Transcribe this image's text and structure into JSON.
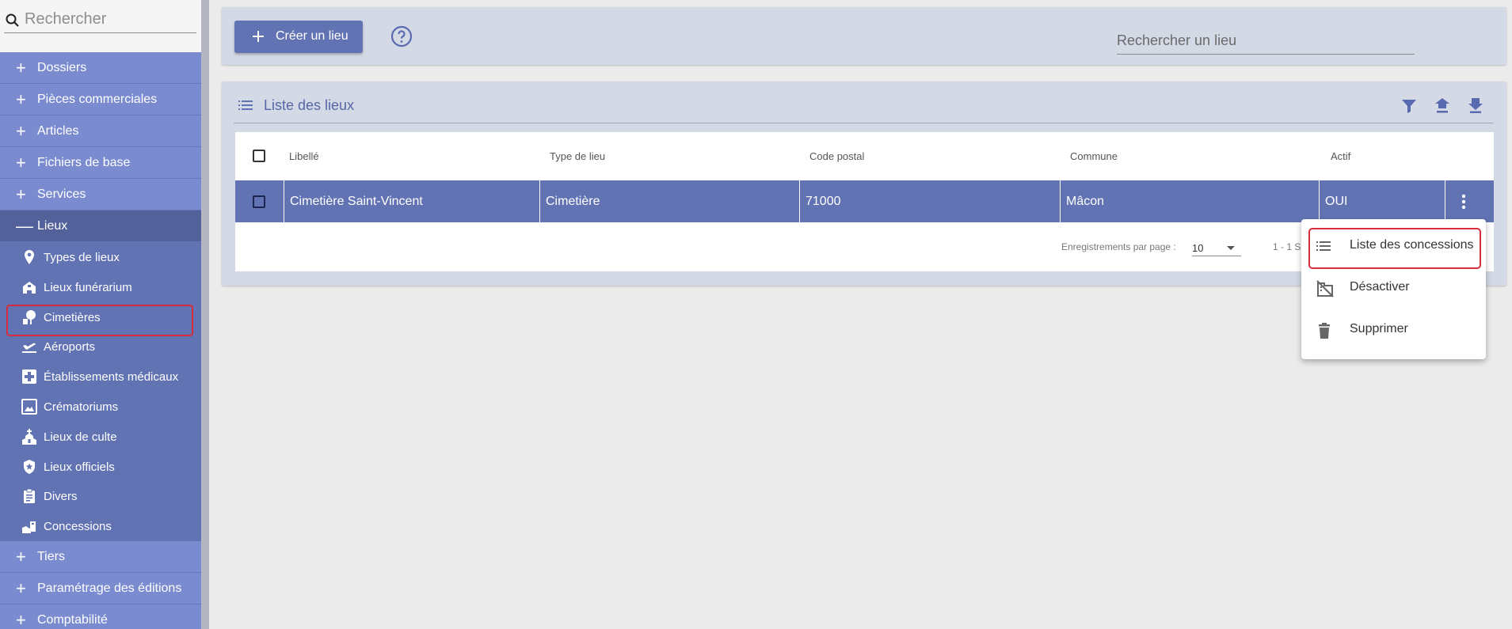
{
  "sidebar": {
    "search_placeholder": "Rechercher",
    "sections_top": [
      {
        "label": "Dossiers",
        "sign": "+"
      },
      {
        "label": "Pièces commerciales",
        "sign": "+"
      },
      {
        "label": "Articles",
        "sign": "+"
      },
      {
        "label": "Fichiers de base",
        "sign": "+"
      },
      {
        "label": "Services",
        "sign": "+"
      }
    ],
    "open_section": {
      "label": "Lieux",
      "sign": "—"
    },
    "sub_items": [
      {
        "label": "Types de lieux",
        "icon": "map-pin-icon"
      },
      {
        "label": "Lieux funérarium",
        "icon": "funeral-home-icon"
      },
      {
        "label": "Cimetières",
        "icon": "cemetery-icon"
      },
      {
        "label": "Aéroports",
        "icon": "airplane-icon"
      },
      {
        "label": "Établissements médicaux",
        "icon": "medical-cross-icon"
      },
      {
        "label": "Crématoriums",
        "icon": "crematorium-icon"
      },
      {
        "label": "Lieux de culte",
        "icon": "church-icon"
      },
      {
        "label": "Lieux officiels",
        "icon": "shield-star-icon"
      },
      {
        "label": "Divers",
        "icon": "clipboard-icon"
      },
      {
        "label": "Concessions",
        "icon": "concession-icon"
      }
    ],
    "sections_bottom": [
      {
        "label": "Tiers",
        "sign": "+"
      },
      {
        "label": "Paramétrage des éditions",
        "sign": "+"
      },
      {
        "label": "Comptabilité",
        "sign": "+"
      }
    ]
  },
  "toolbar": {
    "create_label": "Créer un lieu",
    "search_placeholder": "Rechercher un lieu"
  },
  "panel": {
    "title": "Liste des lieux"
  },
  "table": {
    "columns": [
      "Libellé",
      "Type de lieu",
      "Code postal",
      "Commune",
      "Actif"
    ],
    "rows": [
      {
        "libelle": "Cimetière Saint-Vincent",
        "type": "Cimetière",
        "code_postal": "71000",
        "commune": "Mâcon",
        "actif": "OUI"
      }
    ]
  },
  "pagination": {
    "per_page_label": "Enregistrements par page :",
    "per_page_value": "10",
    "range_text": "1 - 1 S"
  },
  "context_menu": {
    "items": [
      {
        "label": "Liste des concessions",
        "icon": "list-icon"
      },
      {
        "label": "Désactiver",
        "icon": "domain-disabled-icon"
      },
      {
        "label": "Supprimer",
        "icon": "trash-icon"
      }
    ]
  },
  "colors": {
    "primary": "#6273b4",
    "section": "#7b8bd0",
    "highlight": "#d62d3c"
  }
}
